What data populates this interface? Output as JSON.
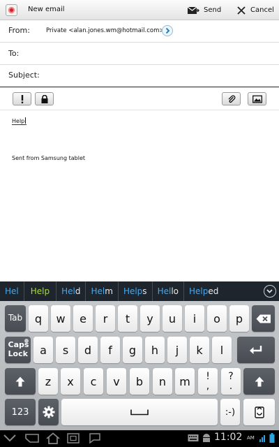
{
  "action_bar": {
    "title": "New email",
    "send_label": "Send",
    "cancel_label": "Cancel"
  },
  "compose": {
    "from_label": "From:",
    "from_value": "Private <alan.jones.wm@hotmail.com>",
    "to_label": "To:",
    "subject_label": "Subject:",
    "body_text": "Help",
    "signature": "Sent from Samsung tablet"
  },
  "toolbar": {
    "icons": [
      "priority-icon",
      "security-lock-icon",
      "attach-icon",
      "insert-image-icon"
    ]
  },
  "suggestions": [
    {
      "prefix": "Hel",
      "rest": "",
      "highlight": false
    },
    {
      "prefix": "",
      "rest": "Help",
      "highlight": true
    },
    {
      "prefix": "Hel",
      "rest": "d",
      "highlight": false
    },
    {
      "prefix": "Hel",
      "rest": "m",
      "highlight": false
    },
    {
      "prefix": "Help",
      "rest": "s",
      "highlight": false
    },
    {
      "prefix": "Hel",
      "rest": "lo",
      "highlight": false
    },
    {
      "prefix": "Help",
      "rest": "ed",
      "highlight": false
    }
  ],
  "keyboard": {
    "row1": [
      "Tab",
      "q",
      "w",
      "e",
      "r",
      "t",
      "y",
      "u",
      "i",
      "o",
      "p"
    ],
    "row2": [
      "Caps Lock",
      "a",
      "s",
      "d",
      "f",
      "g",
      "h",
      "j",
      "k",
      "l"
    ],
    "row3": [
      "z",
      "x",
      "c",
      "v",
      "b",
      "n",
      "m",
      "!",
      ",",
      "?",
      "."
    ],
    "row4": [
      "123",
      ":-)"
    ]
  },
  "status_bar": {
    "time": "11:02",
    "ampm": "AM"
  },
  "colors": {
    "suggestion_prefix": "#4aa6e8",
    "suggestion_highlight": "#a4de2d",
    "suggestion_bar_bg": "#1f252c",
    "keyboard_bg": "#bcc0c3",
    "dark_key": "#52565c",
    "accent_red": "#d0202a"
  }
}
